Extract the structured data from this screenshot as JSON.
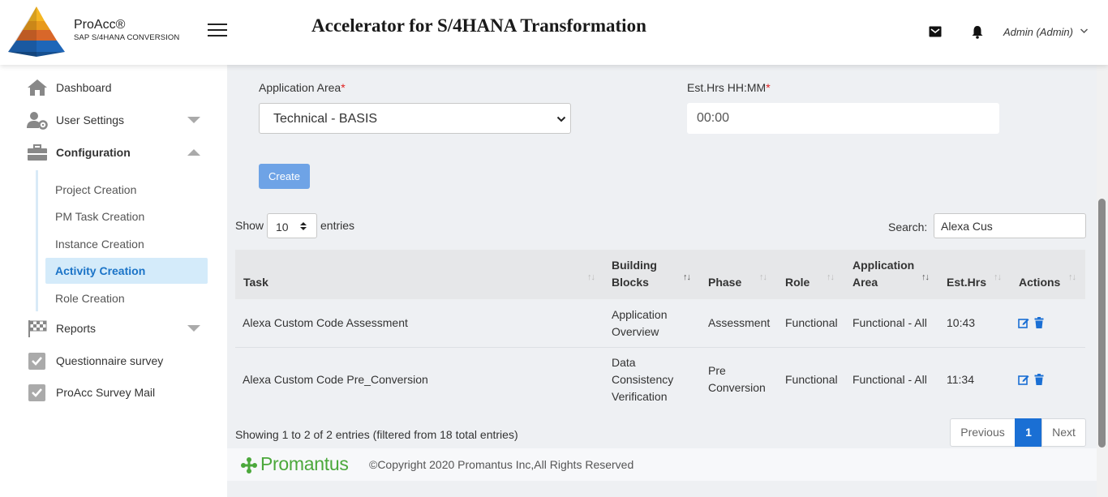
{
  "header": {
    "brand_name": "ProAcc®",
    "brand_sub": "SAP S/4HANA CONVERSION",
    "app_title": "Accelerator for S/4HANA Transformation",
    "user": "Admin (Admin)"
  },
  "sidebar": {
    "items": [
      {
        "label": "Dashboard",
        "icon": "home-icon"
      },
      {
        "label": "User Settings",
        "icon": "user-settings-icon"
      },
      {
        "label": "Configuration",
        "icon": "briefcase-icon"
      },
      {
        "label": "Reports",
        "icon": "checkered-flag-icon"
      },
      {
        "label": "Questionnaire survey",
        "icon": "checkbox-icon"
      },
      {
        "label": "ProAcc Survey Mail",
        "icon": "checkbox-icon"
      }
    ],
    "sub_items": [
      {
        "label": "Project Creation"
      },
      {
        "label": "PM Task Creation"
      },
      {
        "label": "Instance Creation"
      },
      {
        "label": "Activity Creation",
        "active": true
      },
      {
        "label": "Role Creation"
      }
    ]
  },
  "form": {
    "app_area_label": "Application Area",
    "app_area_value": "Technical - BASIS",
    "esthrs_label": "Est.Hrs HH:MM",
    "esthrs_value": "00:00",
    "required_mark": "*",
    "create_label": "Create"
  },
  "table_controls": {
    "show_label": "Show",
    "entries_label": "entries",
    "page_length": "10",
    "search_label": "Search:",
    "search_value": "Alexa Cus"
  },
  "table": {
    "headers": {
      "task": "Task",
      "bb_line1": "Building",
      "bb_line2": "Blocks",
      "phase": "Phase",
      "role": "Role",
      "area_line1": "Application",
      "area_line2": "Area",
      "esthrs": "Est.Hrs",
      "actions": "Actions"
    },
    "rows": [
      {
        "task": "Alexa Custom Code Assessment",
        "bb": [
          "Application",
          "Overview"
        ],
        "phase": [
          "Assessment"
        ],
        "role": "Functional",
        "area": "Functional - All",
        "esthrs": "10:43"
      },
      {
        "task": "Alexa Custom Code Pre_Conversion",
        "bb": [
          "Data",
          "Consistency",
          "Verification"
        ],
        "phase": [
          "Pre",
          "Conversion"
        ],
        "role": "Functional",
        "area": "Functional - All",
        "esthrs": "11:34"
      }
    ]
  },
  "pagination": {
    "info": "Showing 1 to 2 of 2 entries (filtered from 18 total entries)",
    "previous": "Previous",
    "current": "1",
    "next": "Next"
  },
  "footer": {
    "logo_text": "Promantus",
    "copyright": "©Copyright 2020 Promantus Inc,All Rights Reserved"
  },
  "colors": {
    "accent": "#1a6fd4",
    "create_button": "#6ea3e6",
    "active_nav_bg": "#d4ebfa",
    "promantus_green": "#4ba83b"
  }
}
